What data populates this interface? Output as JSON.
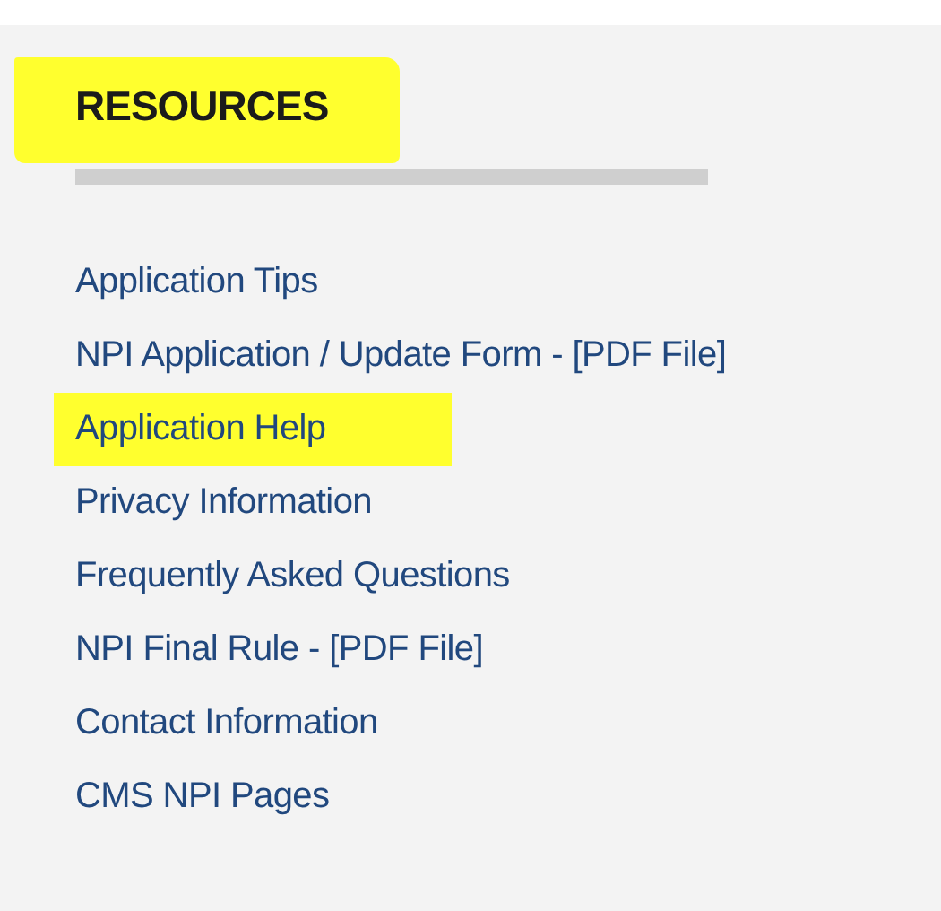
{
  "heading": {
    "text": "RESOURCES",
    "highlighted": true
  },
  "links": [
    {
      "label": "Application Tips",
      "highlighted": false
    },
    {
      "label": "NPI Application / Update Form - [PDF File]",
      "highlighted": false
    },
    {
      "label": "Application Help",
      "highlighted": true
    },
    {
      "label": "Privacy Information",
      "highlighted": false
    },
    {
      "label": "Frequently Asked Questions",
      "highlighted": false
    },
    {
      "label": "NPI Final Rule - [PDF File]",
      "highlighted": false
    },
    {
      "label": "Contact Information",
      "highlighted": false
    },
    {
      "label": "CMS NPI Pages",
      "highlighted": false
    }
  ]
}
